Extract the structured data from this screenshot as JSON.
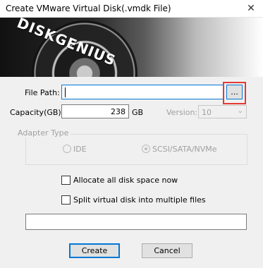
{
  "window": {
    "title": "Create VMware Virtual Disk(.vmdk File)"
  },
  "banner": {
    "logo_text": "DISKGENIUS"
  },
  "form": {
    "file_path_label": "File Path:",
    "file_path_value": "",
    "browse_label": "...",
    "capacity_label": "Capacity(GB):",
    "capacity_value": "238",
    "capacity_unit": "GB",
    "version_label": "Version:",
    "version_value": "10"
  },
  "adapter": {
    "title": "Adapter Type",
    "options": [
      {
        "label": "IDE",
        "selected": false
      },
      {
        "label": "SCSI/SATA/NVMe",
        "selected": true
      }
    ]
  },
  "options": {
    "allocate_label": "Allocate all disk space now",
    "split_label": "Split virtual disk into multiple files"
  },
  "status": {
    "text": ""
  },
  "buttons": {
    "create": "Create",
    "cancel": "Cancel"
  }
}
